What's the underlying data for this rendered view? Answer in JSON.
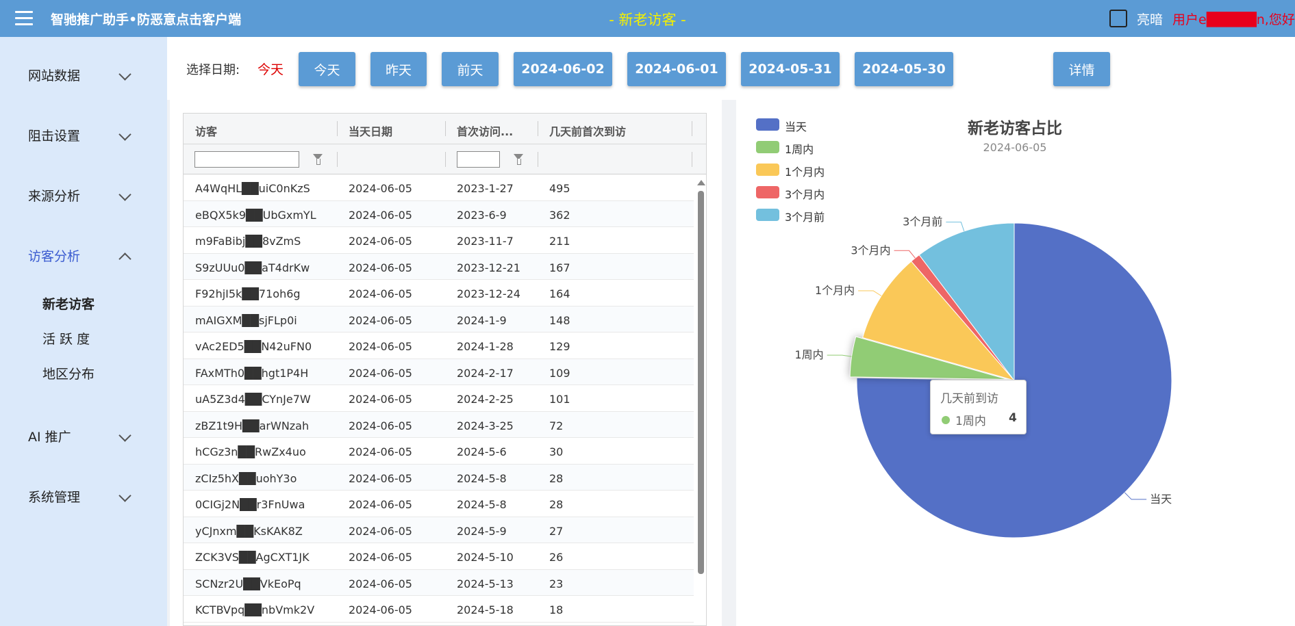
{
  "header": {
    "app_title": "智驰推广助手•防恶意点击客户端",
    "page_title": "- 新老访客 -",
    "theme_label": "亮暗",
    "user_greeting": "用户e█████n,您好!"
  },
  "sidebar": {
    "items": [
      {
        "label": "网站数据",
        "expanded": false
      },
      {
        "label": "阻击设置",
        "expanded": false
      },
      {
        "label": "来源分析",
        "expanded": false
      },
      {
        "label": "访客分析",
        "expanded": true
      },
      {
        "label": "AI 推广",
        "expanded": false
      },
      {
        "label": "系统管理",
        "expanded": false
      }
    ],
    "sub_items": [
      "新老访客",
      "活 跃 度",
      "地区分布"
    ],
    "active_sub": "新老访客"
  },
  "date_bar": {
    "label": "选择日期:",
    "current": "今天",
    "buttons": [
      "今天",
      "昨天",
      "前天",
      "2024-06-02",
      "2024-06-01",
      "2024-05-31",
      "2024-05-30"
    ],
    "details_label": "详情"
  },
  "table": {
    "columns": [
      "访客",
      "当天日期",
      "首次访问...",
      "几天前首次到访"
    ],
    "rows": [
      [
        "A4WqHL██uiC0nKzS",
        "2024-06-05",
        "2023-1-27",
        "495"
      ],
      [
        "eBQX5k9██UbGxmYL",
        "2024-06-05",
        "2023-6-9",
        "362"
      ],
      [
        "m9FaBibj██8vZmS",
        "2024-06-05",
        "2023-11-7",
        "211"
      ],
      [
        "S9zUUu0██aT4drKw",
        "2024-06-05",
        "2023-12-21",
        "167"
      ],
      [
        "F92hjI5k██71oh6g",
        "2024-06-05",
        "2023-12-24",
        "164"
      ],
      [
        "mAIGXM██sjFLp0i",
        "2024-06-05",
        "2024-1-9",
        "148"
      ],
      [
        "vAc2ED5██N42uFN0",
        "2024-06-05",
        "2024-1-28",
        "129"
      ],
      [
        "FAxMTh0██hgt1P4H",
        "2024-06-05",
        "2024-2-17",
        "109"
      ],
      [
        "uA5Z3d4██CYnJe7W",
        "2024-06-05",
        "2024-2-25",
        "101"
      ],
      [
        "zBZ1t9H██arWNzah",
        "2024-06-05",
        "2024-3-25",
        "72"
      ],
      [
        "hCGz3n██RwZx4uo",
        "2024-06-05",
        "2024-5-6",
        "30"
      ],
      [
        "zCIz5hX██uohY3o",
        "2024-06-05",
        "2024-5-8",
        "28"
      ],
      [
        "0CIGj2N██r3FnUwa",
        "2024-06-05",
        "2024-5-8",
        "28"
      ],
      [
        "yCJnxm██KsKAK8Z",
        "2024-06-05",
        "2024-5-9",
        "27"
      ],
      [
        "ZCK3VS██AgCXT1JK",
        "2024-06-05",
        "2024-5-10",
        "26"
      ],
      [
        "SCNzr2U██VkEoPq",
        "2024-06-05",
        "2024-5-13",
        "23"
      ],
      [
        "KCTBVpq██nbVmk2V",
        "2024-06-05",
        "2024-5-18",
        "18"
      ]
    ]
  },
  "chart_data": {
    "type": "pie",
    "title": "新老访客占比",
    "subtitle": "2024-06-05",
    "legend_position": "top-left",
    "categories": [
      "当天",
      "1周内",
      "1个月内",
      "3个月内",
      "3个月前"
    ],
    "values": [
      73,
      4,
      9,
      1,
      10
    ],
    "colors": [
      "#5470c6",
      "#91cc75",
      "#fac858",
      "#ee6666",
      "#73c0de"
    ],
    "highlighted": "1周内"
  },
  "tooltip": {
    "title": "几天前到访",
    "name": "1周内",
    "value": "4"
  }
}
